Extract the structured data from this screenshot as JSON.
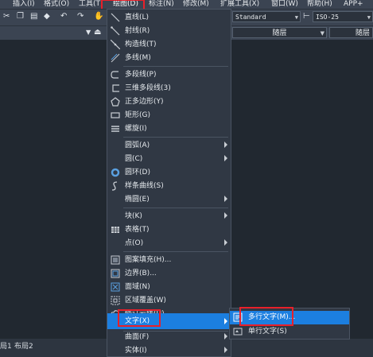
{
  "menubar": {
    "items": [
      "插入(I)",
      "格式(O)",
      "工具(T)",
      "绘图(D)",
      "标注(N)",
      "修改(M)",
      "扩展工具(X)",
      "窗口(W)",
      "帮助(H)",
      "APP+"
    ]
  },
  "toolbar": {
    "text_style": "Standard",
    "dim_style": "ISO-25",
    "linetype": "随层",
    "lineweight": "随层"
  },
  "draw_menu": {
    "items": [
      {
        "label": "直线(L)",
        "icon": "line-icon"
      },
      {
        "label": "射线(R)",
        "icon": "ray-icon"
      },
      {
        "label": "构造线(T)",
        "icon": "xline-icon"
      },
      {
        "label": "多线(M)",
        "icon": "mline-icon"
      },
      {
        "label": "多段线(P)",
        "icon": "polyline-icon"
      },
      {
        "label": "三维多段线(3)",
        "icon": "3d-polyline-icon"
      },
      {
        "label": "正多边形(Y)",
        "icon": "polygon-icon"
      },
      {
        "label": "矩形(G)",
        "icon": "rectangle-icon"
      },
      {
        "label": "螺旋(I)",
        "icon": "helix-icon"
      },
      {
        "label": "圆弧(A)",
        "icon": ""
      },
      {
        "label": "圆(C)",
        "icon": ""
      },
      {
        "label": "圆环(D)",
        "icon": "donut-icon"
      },
      {
        "label": "样条曲线(S)",
        "icon": "spline-icon"
      },
      {
        "label": "椭圆(E)",
        "icon": ""
      },
      {
        "label": "块(K)",
        "icon": ""
      },
      {
        "label": "表格(T)",
        "icon": "table-icon"
      },
      {
        "label": "点(O)",
        "icon": ""
      },
      {
        "label": "图案填充(H)...",
        "icon": "hatch-icon"
      },
      {
        "label": "边界(B)...",
        "icon": "boundary-icon"
      },
      {
        "label": "面域(N)",
        "icon": "region-icon"
      },
      {
        "label": "区域覆盖(W)",
        "icon": "wipeout-icon"
      },
      {
        "label": "修订云线(U)",
        "icon": "revcloud-icon"
      },
      {
        "label": "文字(X)",
        "icon": ""
      },
      {
        "label": "曲面(F)",
        "icon": ""
      },
      {
        "label": "实体(I)",
        "icon": ""
      }
    ]
  },
  "text_submenu": {
    "items": [
      {
        "label": "多行文字(M)...",
        "icon": "mtext-icon"
      },
      {
        "label": "单行文字(S)",
        "icon": "text-icon"
      }
    ]
  },
  "layout_tabs": [
    "局1",
    "布局2"
  ],
  "colors": {
    "highlight": "#1c7fe0",
    "annotation_box": "#e8202a"
  }
}
